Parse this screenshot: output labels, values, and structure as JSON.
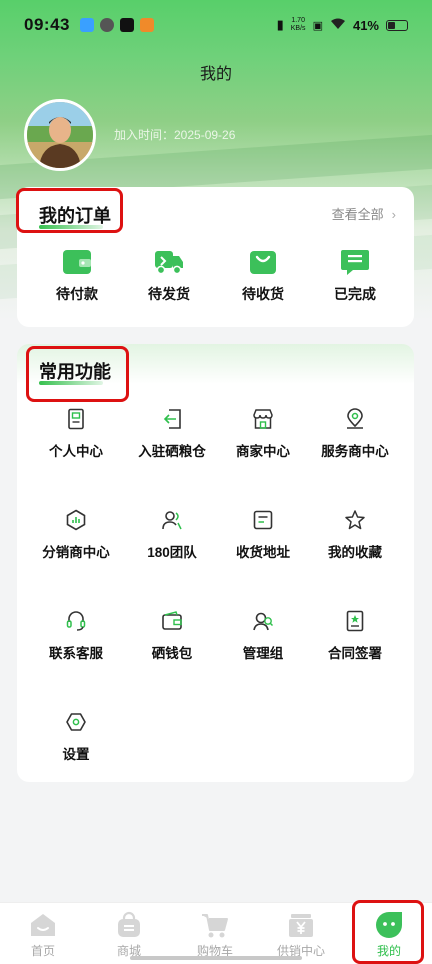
{
  "status_bar": {
    "time": "09:43",
    "net_speed_value": "1.70",
    "net_speed_unit": "KB/s",
    "battery": "41%"
  },
  "header": {
    "title": "我的",
    "join_time": "加入时间：2025-09-26"
  },
  "orders": {
    "title": "我的订单",
    "see_all": "查看全部",
    "items": [
      {
        "label": "待付款",
        "icon": "wallet-icon"
      },
      {
        "label": "待发货",
        "icon": "truck-icon"
      },
      {
        "label": "待收货",
        "icon": "bag-icon"
      },
      {
        "label": "已完成",
        "icon": "message-list-icon"
      }
    ]
  },
  "functions": {
    "title": "常用功能",
    "items": [
      {
        "label": "个人中心",
        "icon": "profile-card-icon"
      },
      {
        "label": "入驻硒粮仓",
        "icon": "enter-icon"
      },
      {
        "label": "商家中心",
        "icon": "store-icon"
      },
      {
        "label": "服务商中心",
        "icon": "location-icon"
      },
      {
        "label": "分销商中心",
        "icon": "hexagon-chart-icon"
      },
      {
        "label": "180团队",
        "icon": "team-icon"
      },
      {
        "label": "收货地址",
        "icon": "address-icon"
      },
      {
        "label": "我的收藏",
        "icon": "star-icon"
      },
      {
        "label": "联系客服",
        "icon": "headset-icon"
      },
      {
        "label": "硒钱包",
        "icon": "wallet-outline-icon"
      },
      {
        "label": "管理组",
        "icon": "group-icon"
      },
      {
        "label": "合同签署",
        "icon": "contract-icon"
      },
      {
        "label": "设置",
        "icon": "settings-icon"
      }
    ]
  },
  "tabbar": {
    "items": [
      {
        "label": "首页",
        "icon": "home-icon",
        "active": false
      },
      {
        "label": "商城",
        "icon": "shop-bag-icon",
        "active": false
      },
      {
        "label": "购物车",
        "icon": "cart-icon",
        "active": false
      },
      {
        "label": "供销中心",
        "icon": "yuan-icon",
        "active": false
      },
      {
        "label": "我的",
        "icon": "profile-face-icon",
        "active": true
      }
    ]
  },
  "colors": {
    "accent": "#2fbf4c",
    "annotation_red": "#d11111"
  }
}
